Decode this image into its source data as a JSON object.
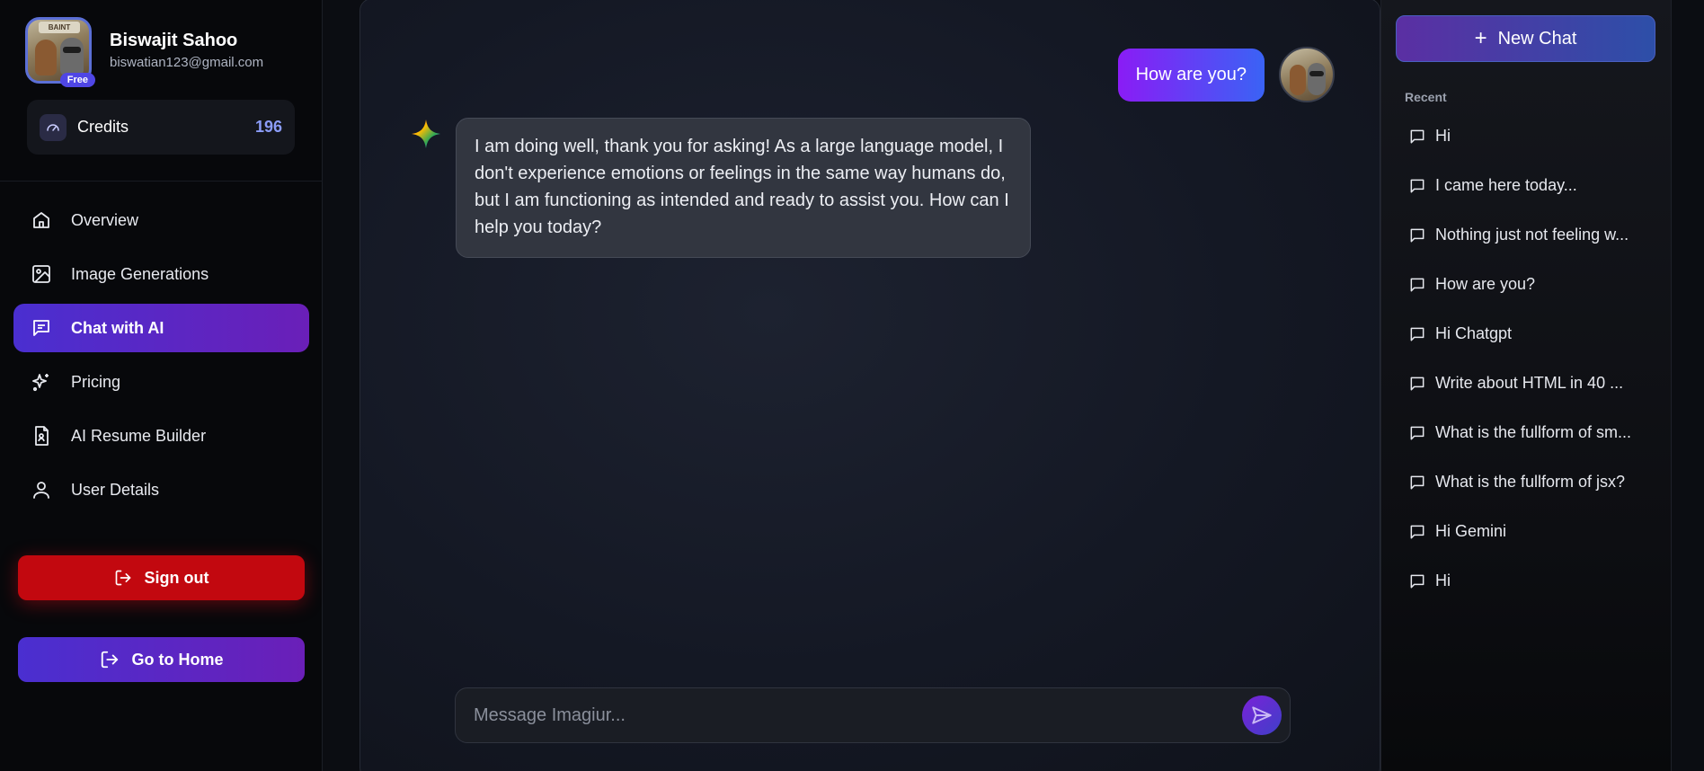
{
  "profile": {
    "name": "Biswajit Sahoo",
    "email": "biswatian123@gmail.com",
    "plan_badge": "Free",
    "avatar_sign": "BAINT"
  },
  "credits": {
    "label": "Credits",
    "value": "196"
  },
  "nav": {
    "items": [
      {
        "label": "Overview",
        "icon": "home-icon",
        "active": false
      },
      {
        "label": "Image Generations",
        "icon": "image-icon",
        "active": false
      },
      {
        "label": "Chat with AI",
        "icon": "chat-icon",
        "active": true
      },
      {
        "label": "Pricing",
        "icon": "sparkles-icon",
        "active": false
      },
      {
        "label": "AI Resume Builder",
        "icon": "resume-icon",
        "active": false
      },
      {
        "label": "User Details",
        "icon": "user-icon",
        "active": false
      }
    ]
  },
  "actions": {
    "sign_out": "Sign out",
    "go_home": "Go to Home"
  },
  "chat": {
    "user_message": "How are you?",
    "ai_message": "I am doing well, thank you for asking! As a large language model, I don't experience emotions or feelings in the same way humans do, but I am functioning as intended and ready to assist you. How can I help you today?",
    "composer_placeholder": "Message Imagiur...",
    "composer_value": ""
  },
  "history": {
    "new_chat_label": "New Chat",
    "recent_label": "Recent",
    "items": [
      "Hi",
      "I came here today...",
      "Nothing just not feeling w...",
      "How are you?",
      "Hi Chatgpt",
      "Write about HTML in 40 ...",
      "What is the fullform of sm...",
      "What is the fullform of jsx?",
      "Hi Gemini",
      "Hi"
    ]
  },
  "colors": {
    "accent_gradient_start": "#4a2fd0",
    "accent_gradient_end": "#6a1fb8",
    "danger": "#c2080f",
    "credits_value": "#8b9cf8"
  }
}
